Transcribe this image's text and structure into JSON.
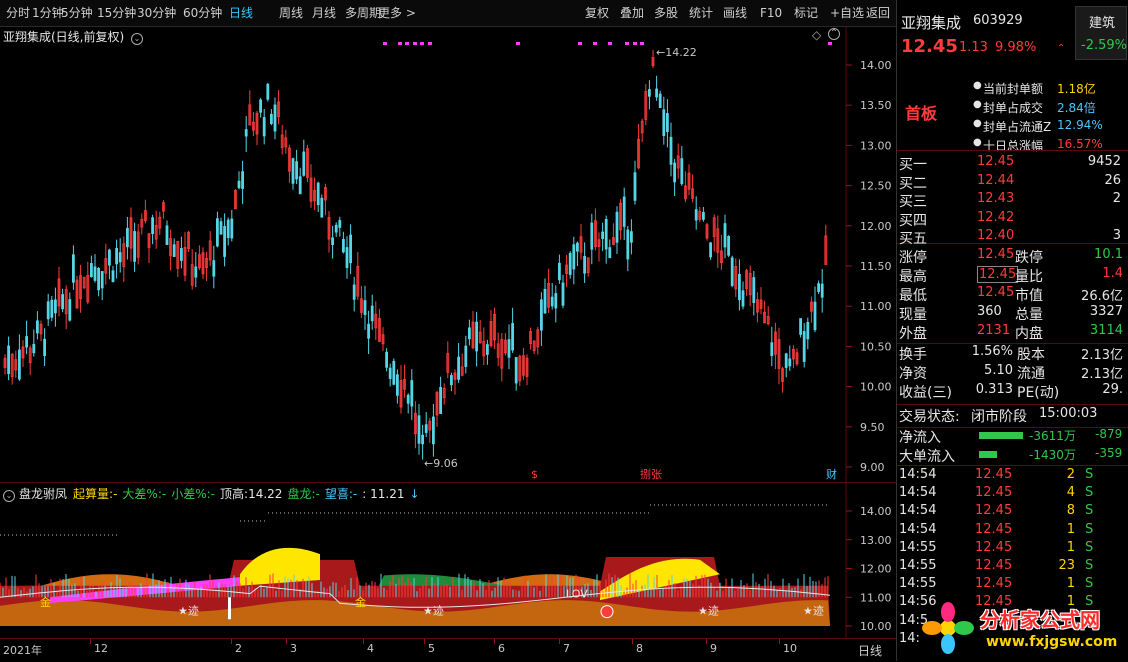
{
  "toolbar": {
    "left": [
      "分时",
      "1分钟",
      "5分钟",
      "15分钟",
      "30分钟",
      "60分钟",
      "日线",
      "周线",
      "月线",
      "多周期",
      "更多 >"
    ],
    "active_index": 6,
    "right": [
      "复权",
      "叠加",
      "多股",
      "统计",
      "画线",
      "F10",
      "标记",
      "+自选",
      "返回"
    ]
  },
  "main_chart": {
    "title": "亚翔集成(日线,前复权)",
    "y_ticks": [
      "14.00",
      "13.50",
      "13.00",
      "12.50",
      "12.00",
      "11.50",
      "11.00",
      "10.50",
      "10.00",
      "9.50",
      "9.00"
    ],
    "high_label": "14.22",
    "low_label": "9.06",
    "markers": [
      "$",
      "捌张",
      "财"
    ]
  },
  "indicator": {
    "name": "盘龙驸凤",
    "items": [
      {
        "label": "起算量",
        "value": "-",
        "color": "#ffd400"
      },
      {
        "label": "大差%",
        "value": "-",
        "color": "#2ec94a"
      },
      {
        "label": "小差%",
        "value": "-",
        "color": "#2ec94a"
      },
      {
        "label": "顶高",
        "value": "14.22",
        "color": "#e6e6e6"
      },
      {
        "label": "盘龙",
        "value": "-",
        "color": "#2ec94a"
      },
      {
        "label": "望喜",
        "value": "-",
        "color": "#47c8ff"
      },
      {
        "label": "",
        "value": "11.21",
        "color": "#e6e6e6"
      }
    ],
    "y_ticks": [
      "14.00",
      "13.00",
      "12.00",
      "11.00",
      "10.00"
    ],
    "labels": [
      "金",
      "金",
      "迹",
      "迹",
      "迹",
      "迹",
      "LOV"
    ]
  },
  "x_axis": {
    "labels": [
      "2021年",
      "12",
      "2",
      "3",
      "4",
      "5",
      "6",
      "7",
      "8",
      "9",
      "10"
    ],
    "period": "日线"
  },
  "stock": {
    "name": "亚翔集成",
    "code": "603929",
    "price": "12.45",
    "change": "1.13",
    "change_pct": "9.98%",
    "sector": "建筑",
    "sector_pct": "-2.59%",
    "badge": "首板",
    "seal_stats": [
      {
        "label": "当前封单额",
        "value": "1.18亿",
        "color": "#ffd400"
      },
      {
        "label": "封单占成交",
        "value": "2.84倍",
        "color": "#47c8ff"
      },
      {
        "label": "封单占流通Z",
        "value": "12.94%",
        "color": "#47c8ff"
      },
      {
        "label": "十日总涨幅",
        "value": "16.57%",
        "color": "#ff3b3b"
      }
    ],
    "bids": [
      {
        "label": "买一",
        "price": "12.45",
        "vol": "9452"
      },
      {
        "label": "买二",
        "price": "12.44",
        "vol": "26"
      },
      {
        "label": "买三",
        "price": "12.43",
        "vol": "2"
      },
      {
        "label": "买四",
        "price": "12.42",
        "vol": ""
      },
      {
        "label": "买五",
        "price": "12.40",
        "vol": "3"
      }
    ],
    "quote_rows": [
      {
        "l1": "涨停",
        "v1": "12.45",
        "c1": "#ff3b3b",
        "l2": "跌停",
        "v2": "10.1",
        "c2": "#2ec94a"
      },
      {
        "l1": "最高",
        "v1": "12.45",
        "c1": "#ff3b3b",
        "l2": "量比",
        "v2": "1.4",
        "c2": "#ff3b3b"
      },
      {
        "l1": "最低",
        "v1": "12.45",
        "c1": "#ff3b3b",
        "l2": "市值",
        "v2": "26.6亿",
        "c2": "#e6e6e6"
      },
      {
        "l1": "现量",
        "v1": "360",
        "c1": "#e6e6e6",
        "l2": "总量",
        "v2": "3327",
        "c2": "#e6e6e6"
      },
      {
        "l1": "外盘",
        "v1": "2131",
        "c1": "#ff3b3b",
        "l2": "内盘",
        "v2": "3114",
        "c2": "#2ec94a"
      }
    ],
    "quote_rows2": [
      {
        "l1": "换手",
        "v1": "1.56%",
        "l2": "股本",
        "v2": "2.13亿"
      },
      {
        "l1": "净资",
        "v1": "5.10",
        "l2": "流通",
        "v2": "2.13亿"
      },
      {
        "l1": "收益(三)",
        "v1": "0.313",
        "l2": "PE(动)",
        "v2": "29."
      }
    ],
    "trade_state_label": "交易状态:",
    "trade_state": "闭市阶段",
    "trade_time": "15:00:03",
    "flows": [
      {
        "label": "净流入",
        "value": "-3611万",
        "value2": "-879"
      },
      {
        "label": "大单流入",
        "value": "-1430万",
        "value2": "-359"
      }
    ],
    "ticks": [
      {
        "time": "14:54",
        "price": "12.45",
        "vol": "2",
        "side": "S"
      },
      {
        "time": "14:54",
        "price": "12.45",
        "vol": "4",
        "side": "S"
      },
      {
        "time": "14:54",
        "price": "12.45",
        "vol": "8",
        "side": "S"
      },
      {
        "time": "14:54",
        "price": "12.45",
        "vol": "1",
        "side": "S"
      },
      {
        "time": "14:55",
        "price": "12.45",
        "vol": "1",
        "side": "S"
      },
      {
        "time": "14:55",
        "price": "12.45",
        "vol": "23",
        "side": "S"
      },
      {
        "time": "14:55",
        "price": "12.45",
        "vol": "1",
        "side": "S"
      },
      {
        "time": "14:56",
        "price": "12.45",
        "vol": "1",
        "side": "S"
      },
      {
        "time": "14:5",
        "price": "",
        "vol": "",
        "side": ""
      },
      {
        "time": "14:",
        "price": "",
        "vol": "",
        "side": ""
      }
    ]
  },
  "watermark": {
    "name": "分析家公式网",
    "url": "www.fxjgsw.com"
  }
}
